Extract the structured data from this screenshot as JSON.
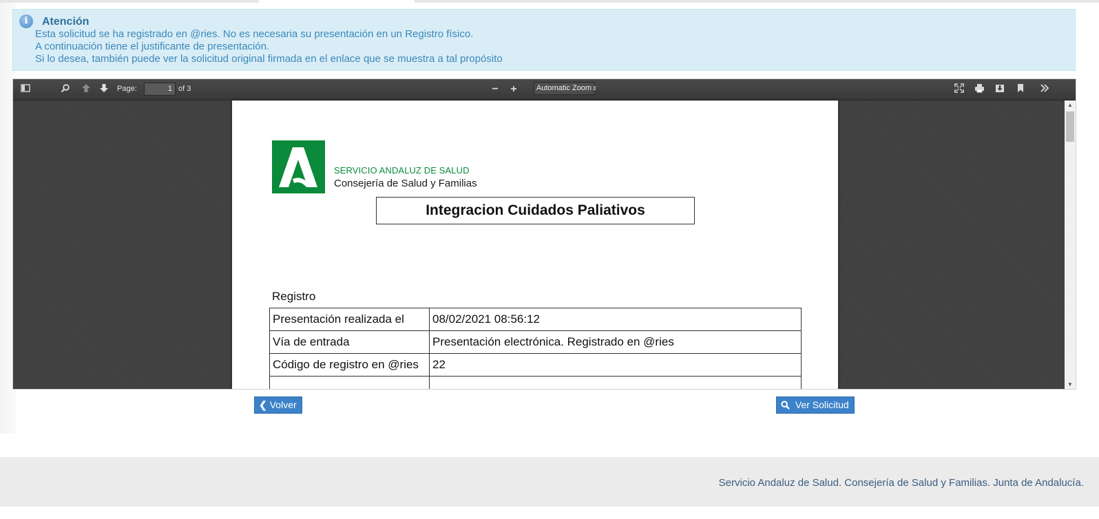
{
  "alert": {
    "title": "Atención",
    "lines": [
      "Esta solicitud se ha registrado en @ries. No es necesaria su presentación en un Registro físico.",
      "A continuación tiene el justificante de presentación.",
      "Si lo desea, también puede ver la solicitud original firmada en el enlace que se muestra a tal propósito"
    ]
  },
  "viewer": {
    "page_label": "Page:",
    "page_value": "1",
    "page_total": "of 3",
    "zoom_selected": "Automatic Zoom",
    "zoom_out": "−",
    "zoom_in": "+"
  },
  "document": {
    "org_line_1": "SERVICIO ANDALUZ DE SALUD",
    "org_line_2": "Consejería de Salud y Familias",
    "title": "Integracion Cuidados Paliativos",
    "section": "Registro",
    "rows": [
      {
        "key": "Presentación realizada el",
        "value": "08/02/2021 08:56:12"
      },
      {
        "key": "Vía de entrada",
        "value": "Presentación electrónica. Registrado en @ries"
      },
      {
        "key": "Código de registro en @ries",
        "value": "22"
      },
      {
        "key": "",
        "value": ""
      }
    ]
  },
  "actions": {
    "back_label": "Volver",
    "view_label": "Ver Solicitud"
  },
  "footer": {
    "text": "Servicio Andaluz de Salud. Consejería de Salud y Familias. Junta de Andalucía."
  },
  "colors": {
    "alert_bg": "#d9edf7",
    "alert_text": "#31708f",
    "brand_green": "#0a8a3a",
    "button_blue": "#3c82c8",
    "viewer_bg": "#404040"
  },
  "icons": [
    "info-icon",
    "sidebar-toggle-icon",
    "search-icon",
    "arrow-up-icon",
    "arrow-down-icon",
    "fullscreen-icon",
    "print-icon",
    "download-icon",
    "bookmark-icon",
    "double-chevron-right-icon",
    "chevron-left-icon"
  ]
}
